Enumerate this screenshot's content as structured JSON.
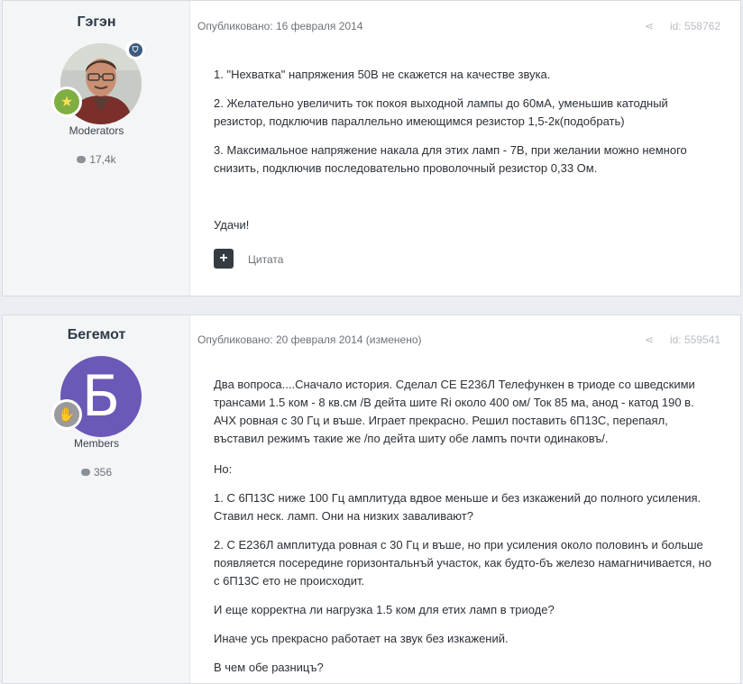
{
  "posts": [
    {
      "author": "Гэгэн",
      "group": "Moderators",
      "post_count": "17,4k",
      "avatar_icon": "user-photo-icon",
      "badge": "moderator-shield-icon",
      "rank_icon": "star-icon",
      "published": "Опубликовано: 16 февраля 2014",
      "post_id": "id: 558762",
      "paragraphs": [
        "1. \"Нехватка\" напряжения 50В не скажется на качестве звука.",
        "2. Желательно увеличить ток покоя выходной лампы до 60мА, уменьшив катодный резистор, подключив параллельно имеющимся резистор 1,5-2к(подобрать)",
        "3. Максимальное напряжение накала для этих ламп - 7В, при желании можно немного снизить, подключив последовательно проволочный резистор 0,33 Ом.",
        "Удачи!"
      ],
      "quote_button": "+",
      "quote_label": "Цитата"
    },
    {
      "author": "Бегемот",
      "group": "Members",
      "post_count": "356",
      "avatar_letter": "Б",
      "rank_icon": "hand-icon",
      "published": "Опубликовано: 20 февраля 2014 (изменено)",
      "post_id": "id: 559541",
      "paragraphs": [
        "Два вопроса....Сначало история. Сделал СЕ Е236Л Телефункен в триоде со шведскими трансами 1.5 ком - 8 кв.см /В дейта шите Ri около 400 ом/ Ток 85 ма, анод - катод 190 в. АЧХ ровная с 30 Гц и въше. Играет прекрасно. Решил поставить 6П13С, перепаял, въставил режимъ такие же /по дейта шиту обе лампъ почти одинаковъ/.",
        "Но:",
        "1. С 6П13С ниже 100 Гц амплитуда вдвое меньше и без изкажений до полного усиления. Ставил неск. ламп. Они на низких заваливают?",
        "2. С Е236Л амплитуда ровная с 30 Гц и въше, но при усиления около половинъ и больше появляется посередине горизонтальнъй участок, как будто-бъ железо намагничивается, но с 6П13С ето не происходит.",
        "И еще корректна ли нагрузка 1.5 ком для етих ламп в триоде?",
        "Иначе усь прекрасно работает на звук без изкажений.",
        "В чем обе разницъ?"
      ]
    }
  ],
  "colors": {
    "page_bg": "#ebeef2",
    "author_panel_bg": "#f3f5f7",
    "avatar_letter_bg": "#6b58b7",
    "rank_star_bg": "#7fae42"
  }
}
